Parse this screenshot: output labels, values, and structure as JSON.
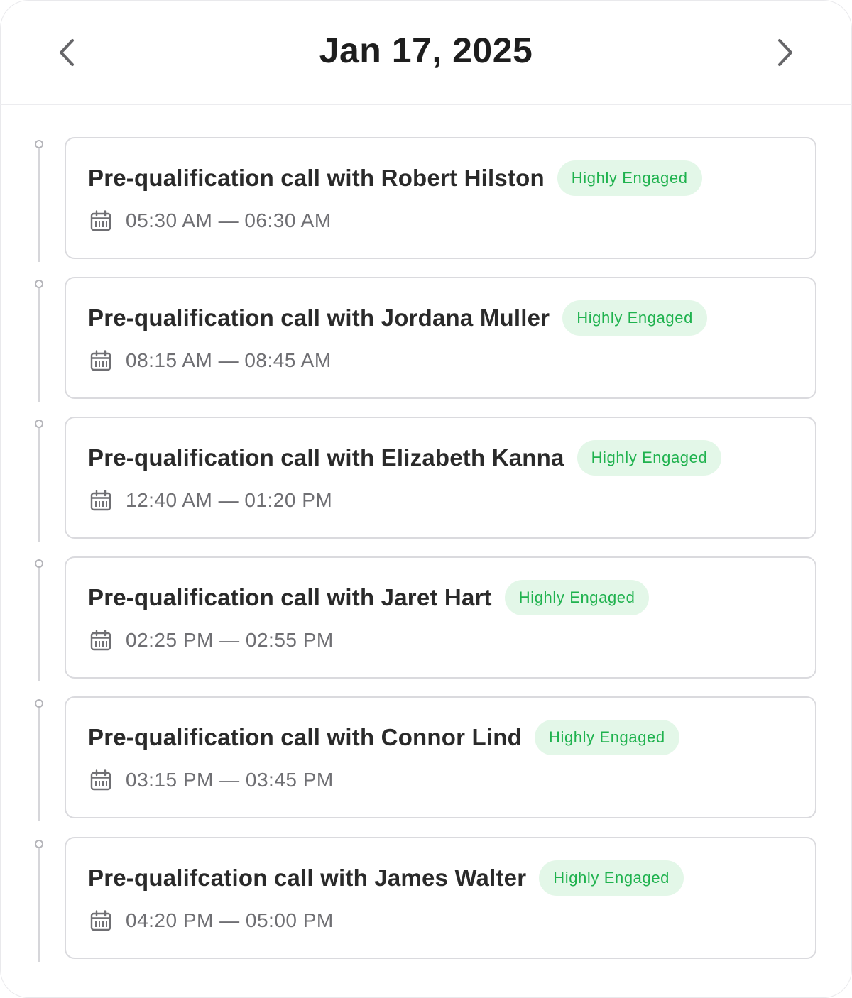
{
  "header": {
    "date": "Jan 17, 2025",
    "prev_icon": "chevron-left-icon",
    "next_icon": "chevron-right-icon"
  },
  "colors": {
    "badge_text": "#1fb24e",
    "badge_bg": "#e3f7e8",
    "title_text": "#2a2a2a",
    "time_text": "#6f6f73"
  },
  "events": [
    {
      "title": "Pre-qualification call with Robert Hilston",
      "badge": "Highly Engaged",
      "time": "05:30 AM — 06:30 AM",
      "icon": "calendar-icon"
    },
    {
      "title": "Pre-qualification call with Jordana Muller",
      "badge": "Highly Engaged",
      "time": "08:15 AM — 08:45 AM",
      "icon": "calendar-icon"
    },
    {
      "title": "Pre-qualification call with Elizabeth Kanna",
      "badge": "Highly Engaged",
      "time": "12:40 AM — 01:20 PM",
      "icon": "calendar-icon"
    },
    {
      "title": "Pre-qualification call with Jaret Hart",
      "badge": "Highly Engaged",
      "time": "02:25 PM — 02:55 PM",
      "icon": "calendar-icon"
    },
    {
      "title": "Pre-qualification call with Connor Lind",
      "badge": "Highly Engaged",
      "time": "03:15 PM — 03:45 PM",
      "icon": "calendar-icon"
    },
    {
      "title": "Pre-qualifcation call with James Walter",
      "badge": "Highly Engaged",
      "time": "04:20 PM  — 05:00 PM",
      "icon": "calendar-icon"
    }
  ]
}
